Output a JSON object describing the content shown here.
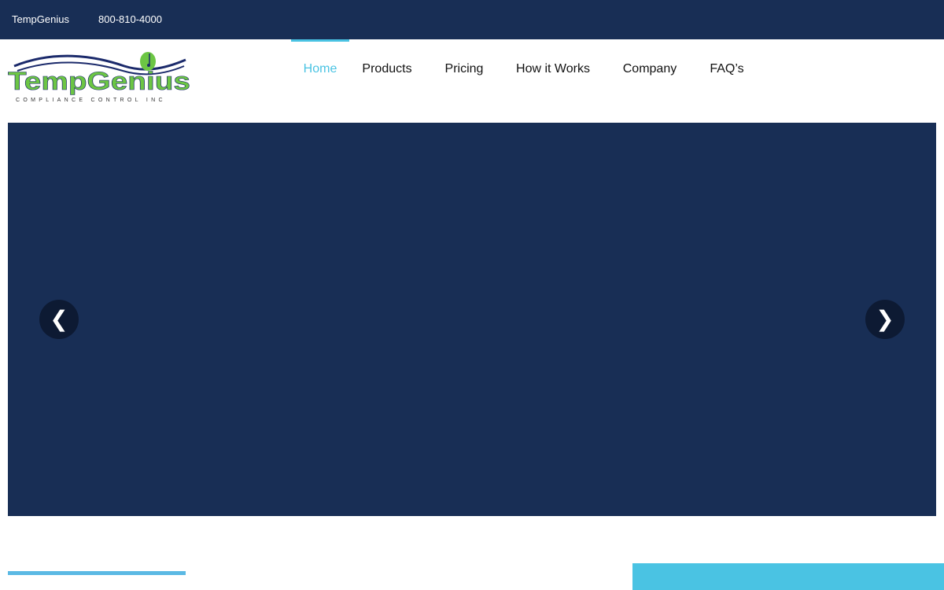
{
  "topbar": {
    "brand": "TempGenius",
    "phone": "800-810-4000"
  },
  "logo": {
    "name": "TempGenius",
    "tagline": "COMPLIANCE CONTROL INC"
  },
  "nav": {
    "items": [
      {
        "label": "Home",
        "active": true
      },
      {
        "label": "Products"
      },
      {
        "label": "Pricing"
      },
      {
        "label": "How it Works"
      },
      {
        "label": "Company"
      },
      {
        "label": "FAQ’s"
      }
    ]
  },
  "hero": {
    "prev_icon": "❮",
    "next_icon": "❯"
  },
  "colors": {
    "navy": "#182e55",
    "accent": "#4ac3e3",
    "logo_green": "#6cc644"
  }
}
